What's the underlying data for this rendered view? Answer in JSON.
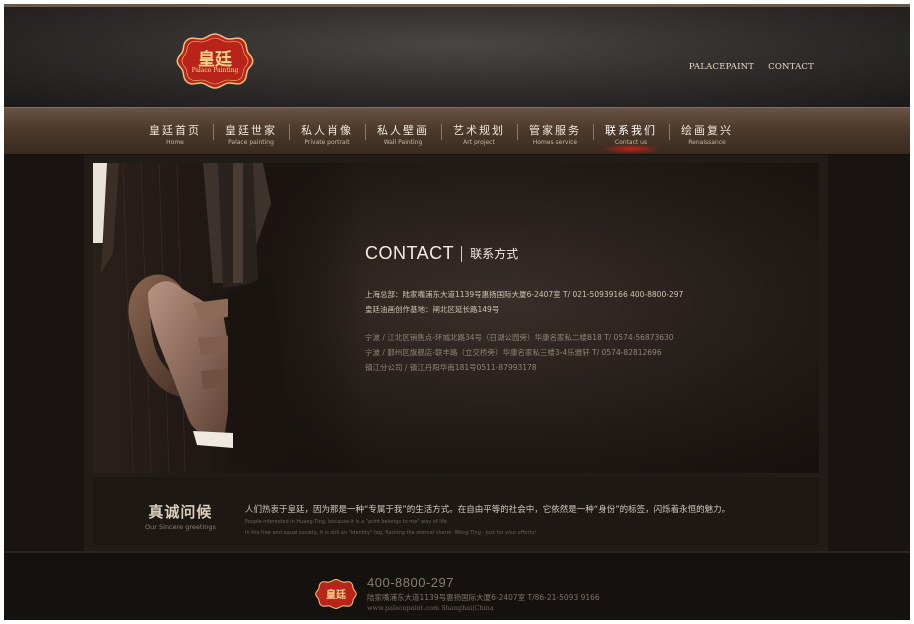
{
  "logo": {
    "cn": "皇廷",
    "en": "Palace Painting"
  },
  "top_links": [
    "PALACEPAINT",
    "CONTACT"
  ],
  "nav": [
    {
      "cn": "皇廷首页",
      "en": "Home"
    },
    {
      "cn": "皇廷世家",
      "en": "Palace painting"
    },
    {
      "cn": "私人肖像",
      "en": "Private portrait"
    },
    {
      "cn": "私人壁画",
      "en": "Wall Painting"
    },
    {
      "cn": "艺术规划",
      "en": "Art project"
    },
    {
      "cn": "管家服务",
      "en": "Homes service"
    },
    {
      "cn": "联系我们",
      "en": "Contact us",
      "active": true
    },
    {
      "cn": "绘画复兴",
      "en": "Renaissance"
    }
  ],
  "contact": {
    "title_en": "CONTACT",
    "title_cn": "联系方式",
    "hq": "上海总部：陆家嘴浦东大道1139号惠扬国际大厦6-2407室 T/ 021-50939166 400-8800-297",
    "studio": "皇廷油画创作基地：闸北区延长路149号",
    "ningbo1": "宁波 / 江北区销售点-环城北路34号（日湖公园旁）华康名家私二楼B18 T/ 0574-56873630",
    "ningbo2": "宁波 / 鄞州区旗舰店-联丰路（立交桥旁）华康名家私三楼3-4乐雅轩 T/ 0574-82812696",
    "zhenjiang": "镇江分公司 / 镇江丹阳华南181号0511-87993178"
  },
  "sincere": {
    "title_cn": "真诚问候",
    "title_en": "Our Sincere greetings",
    "text": "人们热衷于皇廷，因为那是一种“专属于我”的生活方式。在自由平等的社会中，它依然是一种“身份”的标签，闪烁着永恒的魅力。",
    "sub1": "People interested in Huang Ting, because it is a \"print belongs to me\" way of life.",
    "sub2": "In the free and equal society, it is still an \"identity\" tag, flashing the eternal charm. Wong Ting - just for your efforts!"
  },
  "footer": {
    "logo_cn": "皇廷",
    "phone": "400-8800-297",
    "address": "陆家嘴浦东大道1139号惠扬国际大厦6-2407室 T/86-21-5093 9166",
    "site": "www.palacepaint.com Shanghai|China"
  },
  "colors": {
    "accent_red": "#b8241a",
    "gold": "#e8c27a",
    "bg_dark": "#191412"
  }
}
